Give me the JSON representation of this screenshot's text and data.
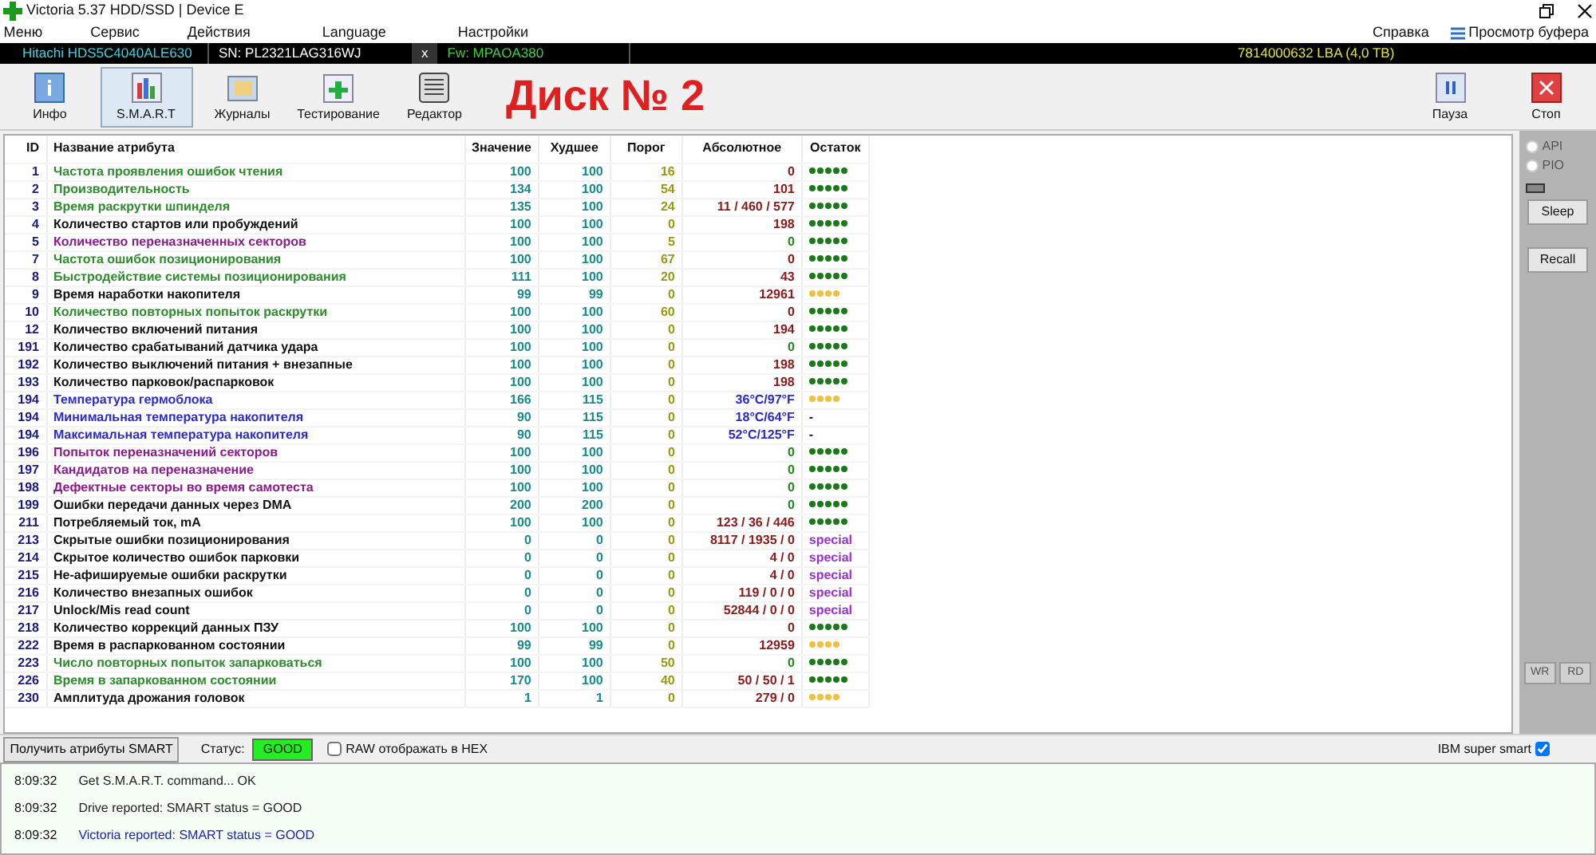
{
  "window": {
    "title": "Victoria 5.37 HDD/SSD | Device E"
  },
  "menu": {
    "items": [
      "Меню",
      "Сервис",
      "Действия",
      "Language",
      "Настройки"
    ],
    "help": "Справка",
    "buffer": "Просмотр буфера"
  },
  "drive": {
    "model": "Hitachi HDS5C4040ALE630",
    "serial": "SN: PL2321LAG316WJ",
    "close": "x",
    "firmware": "Fw: MPAOA380",
    "capacity": "7814000632 LBA (4,0 TB)"
  },
  "toolbar": {
    "buttons": [
      {
        "label": "Инфо",
        "kind": "info",
        "selected": false
      },
      {
        "label": "S.M.A.R.T",
        "kind": "smart",
        "selected": true
      },
      {
        "label": "Журналы",
        "kind": "logs",
        "selected": false
      },
      {
        "label": "Тестирование",
        "kind": "test",
        "selected": false
      },
      {
        "label": "Редактор",
        "kind": "editor",
        "selected": false
      }
    ],
    "heading": "Диск № 2",
    "right_buttons": [
      {
        "label": "Пауза",
        "kind": "pause"
      },
      {
        "label": "Стоп",
        "kind": "stop"
      }
    ]
  },
  "table": {
    "columns": [
      "ID",
      "Название атрибута",
      "Значение",
      "Худшее",
      "Порог",
      "Абсолютное",
      "Остаток"
    ],
    "rows": [
      {
        "id": "1",
        "name": "Частота проявления ошибок чтения",
        "color": "#2e8b2e",
        "value": "100",
        "worst": "100",
        "threshold": "16",
        "raw": {
          "text": "0",
          "color": "#8b1a1a"
        },
        "remainder": {
          "kind": "dots",
          "stars": 5
        }
      },
      {
        "id": "2",
        "name": "Производительность",
        "color": "#2e8b2e",
        "value": "134",
        "worst": "100",
        "threshold": "54",
        "raw": {
          "text": "101",
          "color": "#8b1a1a"
        },
        "remainder": {
          "kind": "dots",
          "stars": 5
        }
      },
      {
        "id": "3",
        "name": "Время раскрутки шпинделя",
        "color": "#2e8b2e",
        "value": "135",
        "worst": "100",
        "threshold": "24",
        "raw": {
          "text": "11 / 460 / 577",
          "color": "#8b1a1a"
        },
        "remainder": {
          "kind": "dots",
          "stars": 5
        }
      },
      {
        "id": "4",
        "name": "Количество стартов или пробуждений",
        "color": "#111111",
        "value": "100",
        "worst": "100",
        "threshold": "0",
        "raw": {
          "text": "198",
          "color": "#8b1a1a"
        },
        "remainder": {
          "kind": "dots",
          "stars": 5
        }
      },
      {
        "id": "5",
        "name": "Количество переназначенных секторов",
        "color": "#8b1a8b",
        "value": "100",
        "worst": "100",
        "threshold": "5",
        "raw": {
          "text": "0",
          "color": "#1e8b1e"
        },
        "remainder": {
          "kind": "dots",
          "stars": 5
        }
      },
      {
        "id": "7",
        "name": "Частота ошибок позиционирования",
        "color": "#2e8b2e",
        "value": "100",
        "worst": "100",
        "threshold": "67",
        "raw": {
          "text": "0",
          "color": "#8b1a1a"
        },
        "remainder": {
          "kind": "dots",
          "stars": 5
        }
      },
      {
        "id": "8",
        "name": "Быстродействие системы позиционирования",
        "color": "#2e8b2e",
        "value": "111",
        "worst": "100",
        "threshold": "20",
        "raw": {
          "text": "43",
          "color": "#8b1a1a"
        },
        "remainder": {
          "kind": "dots",
          "stars": 5
        }
      },
      {
        "id": "9",
        "name": "Время наработки накопителя",
        "color": "#111111",
        "value": "99",
        "worst": "99",
        "threshold": "0",
        "raw": {
          "text": "12961",
          "color": "#8b1a1a"
        },
        "remainder": {
          "kind": "dots",
          "stars": 4
        }
      },
      {
        "id": "10",
        "name": "Количество повторных попыток раскрутки",
        "color": "#2e8b2e",
        "value": "100",
        "worst": "100",
        "threshold": "60",
        "raw": {
          "text": "0",
          "color": "#8b1a1a"
        },
        "remainder": {
          "kind": "dots",
          "stars": 5
        }
      },
      {
        "id": "12",
        "name": "Количество включений питания",
        "color": "#111111",
        "value": "100",
        "worst": "100",
        "threshold": "0",
        "raw": {
          "text": "194",
          "color": "#8b1a1a"
        },
        "remainder": {
          "kind": "dots",
          "stars": 5
        }
      },
      {
        "id": "191",
        "name": "Количество срабатываний датчика удара",
        "color": "#111111",
        "value": "100",
        "worst": "100",
        "threshold": "0",
        "raw": {
          "text": "0",
          "color": "#1e8b1e"
        },
        "remainder": {
          "kind": "dots",
          "stars": 5
        }
      },
      {
        "id": "192",
        "name": "Количество выключений питания + внезапные",
        "color": "#111111",
        "value": "100",
        "worst": "100",
        "threshold": "0",
        "raw": {
          "text": "198",
          "color": "#8b1a1a"
        },
        "remainder": {
          "kind": "dots",
          "stars": 5
        }
      },
      {
        "id": "193",
        "name": "Количество парковок/распарковок",
        "color": "#111111",
        "value": "100",
        "worst": "100",
        "threshold": "0",
        "raw": {
          "text": "198",
          "color": "#8b1a1a"
        },
        "remainder": {
          "kind": "dots",
          "stars": 5
        }
      },
      {
        "id": "194",
        "name": "Температура гермоблока",
        "color": "#2a2ad0",
        "value": "166",
        "worst": "115",
        "threshold": "0",
        "raw": {
          "text": "36°C/97°F",
          "color": "#2a2ad0"
        },
        "remainder": {
          "kind": "dots",
          "stars": 4
        }
      },
      {
        "id": "194",
        "name": "Минимальная температура накопителя",
        "color": "#2a2ad0",
        "value": "90",
        "worst": "115",
        "threshold": "0",
        "raw": {
          "text": "18°C/64°F",
          "color": "#2a2ad0"
        },
        "remainder": {
          "kind": "text",
          "text": "-",
          "color": "#111111"
        }
      },
      {
        "id": "194",
        "name": "Максимальная температура накопителя",
        "color": "#2a2ad0",
        "value": "90",
        "worst": "115",
        "threshold": "0",
        "raw": {
          "text": "52°C/125°F",
          "color": "#2a2ad0"
        },
        "remainder": {
          "kind": "text",
          "text": "-",
          "color": "#111111"
        }
      },
      {
        "id": "196",
        "name": "Попыток переназначений секторов",
        "color": "#8b1a8b",
        "value": "100",
        "worst": "100",
        "threshold": "0",
        "raw": {
          "text": "0",
          "color": "#1e8b1e"
        },
        "remainder": {
          "kind": "dots",
          "stars": 5
        }
      },
      {
        "id": "197",
        "name": "Кандидатов на переназначение",
        "color": "#8b1a8b",
        "value": "100",
        "worst": "100",
        "threshold": "0",
        "raw": {
          "text": "0",
          "color": "#1e8b1e"
        },
        "remainder": {
          "kind": "dots",
          "stars": 5
        }
      },
      {
        "id": "198",
        "name": "Дефектные секторы во время самотеста",
        "color": "#8b1a8b",
        "value": "100",
        "worst": "100",
        "threshold": "0",
        "raw": {
          "text": "0",
          "color": "#1e8b1e"
        },
        "remainder": {
          "kind": "dots",
          "stars": 5
        }
      },
      {
        "id": "199",
        "name": "Ошибки передачи данных через DMA",
        "color": "#111111",
        "value": "200",
        "worst": "200",
        "threshold": "0",
        "raw": {
          "text": "0",
          "color": "#1e8b1e"
        },
        "remainder": {
          "kind": "dots",
          "stars": 5
        }
      },
      {
        "id": "211",
        "name": "Потребляемый ток, mA",
        "color": "#111111",
        "value": "100",
        "worst": "100",
        "threshold": "0",
        "raw": {
          "text": "123 / 36 / 446",
          "color": "#8b1a1a"
        },
        "remainder": {
          "kind": "dots",
          "stars": 5
        }
      },
      {
        "id": "213",
        "name": "Скрытые ошибки позиционирования",
        "color": "#111111",
        "value": "0",
        "worst": "0",
        "threshold": "0",
        "raw": {
          "text": "8117 / 1935 / 0",
          "color": "#8b1a1a"
        },
        "remainder": {
          "kind": "text",
          "text": "special",
          "color": "#9b30d0"
        }
      },
      {
        "id": "214",
        "name": "Скрытое количество ошибок парковки",
        "color": "#111111",
        "value": "0",
        "worst": "0",
        "threshold": "0",
        "raw": {
          "text": "4 / 0",
          "color": "#8b1a1a"
        },
        "remainder": {
          "kind": "text",
          "text": "special",
          "color": "#9b30d0"
        }
      },
      {
        "id": "215",
        "name": "Не-афишируемые ошибки раскрутки",
        "color": "#111111",
        "value": "0",
        "worst": "0",
        "threshold": "0",
        "raw": {
          "text": "4 / 0",
          "color": "#8b1a1a"
        },
        "remainder": {
          "kind": "text",
          "text": "special",
          "color": "#9b30d0"
        }
      },
      {
        "id": "216",
        "name": "Количество внезапных ошибок",
        "color": "#111111",
        "value": "0",
        "worst": "0",
        "threshold": "0",
        "raw": {
          "text": "119 / 0 / 0",
          "color": "#8b1a1a"
        },
        "remainder": {
          "kind": "text",
          "text": "special",
          "color": "#9b30d0"
        }
      },
      {
        "id": "217",
        "name": "Unlock/Mis read count",
        "color": "#111111",
        "value": "0",
        "worst": "0",
        "threshold": "0",
        "raw": {
          "text": "52844 / 0 / 0",
          "color": "#8b1a1a"
        },
        "remainder": {
          "kind": "text",
          "text": "special",
          "color": "#9b30d0"
        }
      },
      {
        "id": "218",
        "name": "Количество коррекций данных ПЗУ",
        "color": "#111111",
        "value": "100",
        "worst": "100",
        "threshold": "0",
        "raw": {
          "text": "0",
          "color": "#8b1a1a"
        },
        "remainder": {
          "kind": "dots",
          "stars": 5
        }
      },
      {
        "id": "222",
        "name": "Время в распаркованном состоянии",
        "color": "#111111",
        "value": "99",
        "worst": "99",
        "threshold": "0",
        "raw": {
          "text": "12959",
          "color": "#8b1a1a"
        },
        "remainder": {
          "kind": "dots",
          "stars": 4
        }
      },
      {
        "id": "223",
        "name": "Число повторных попыток запарковаться",
        "color": "#2e8b2e",
        "value": "100",
        "worst": "100",
        "threshold": "50",
        "raw": {
          "text": "0",
          "color": "#1e8b1e"
        },
        "remainder": {
          "kind": "dots",
          "stars": 5
        }
      },
      {
        "id": "226",
        "name": "Время в запаркованном состоянии",
        "color": "#2e8b2e",
        "value": "170",
        "worst": "100",
        "threshold": "40",
        "raw": {
          "text": "50 / 50 / 1",
          "color": "#8b1a1a"
        },
        "remainder": {
          "kind": "dots",
          "stars": 5
        }
      },
      {
        "id": "230",
        "name": "Амплитуда дрожания головок",
        "color": "#111111",
        "value": "1",
        "worst": "1",
        "threshold": "0",
        "raw": {
          "text": "279 / 0",
          "color": "#8b1a1a"
        },
        "remainder": {
          "kind": "dots",
          "stars": 4
        }
      }
    ]
  },
  "side_panel": {
    "radios": [
      {
        "label": "API",
        "selected": false
      },
      {
        "label": "PIO",
        "selected": false
      }
    ],
    "buttons": [
      {
        "label": "Sleep",
        "disabled": false
      },
      {
        "label": "Recall",
        "disabled": false
      }
    ],
    "small_buttons": [
      {
        "label": "WR",
        "disabled": true
      },
      {
        "label": "RD",
        "disabled": true
      }
    ]
  },
  "bottom_bar": {
    "get_button": "Получить атрибуты SMART",
    "status_label": "Статус:",
    "status": "GOOD",
    "raw_hex": {
      "label": "RAW отображать в HEX",
      "checked": false
    },
    "ibm": {
      "label": "IBM super smart",
      "checked": true
    }
  },
  "log": [
    {
      "time": "8:09:32",
      "text": "Get S.M.A.R.T. command... OK",
      "kind": "plain"
    },
    {
      "time": "8:09:32",
      "text": "Drive reported: SMART status = GOOD",
      "kind": "plain"
    },
    {
      "time": "8:09:32",
      "text": "Victoria reported: SMART status = GOOD",
      "kind": "highlight"
    }
  ]
}
